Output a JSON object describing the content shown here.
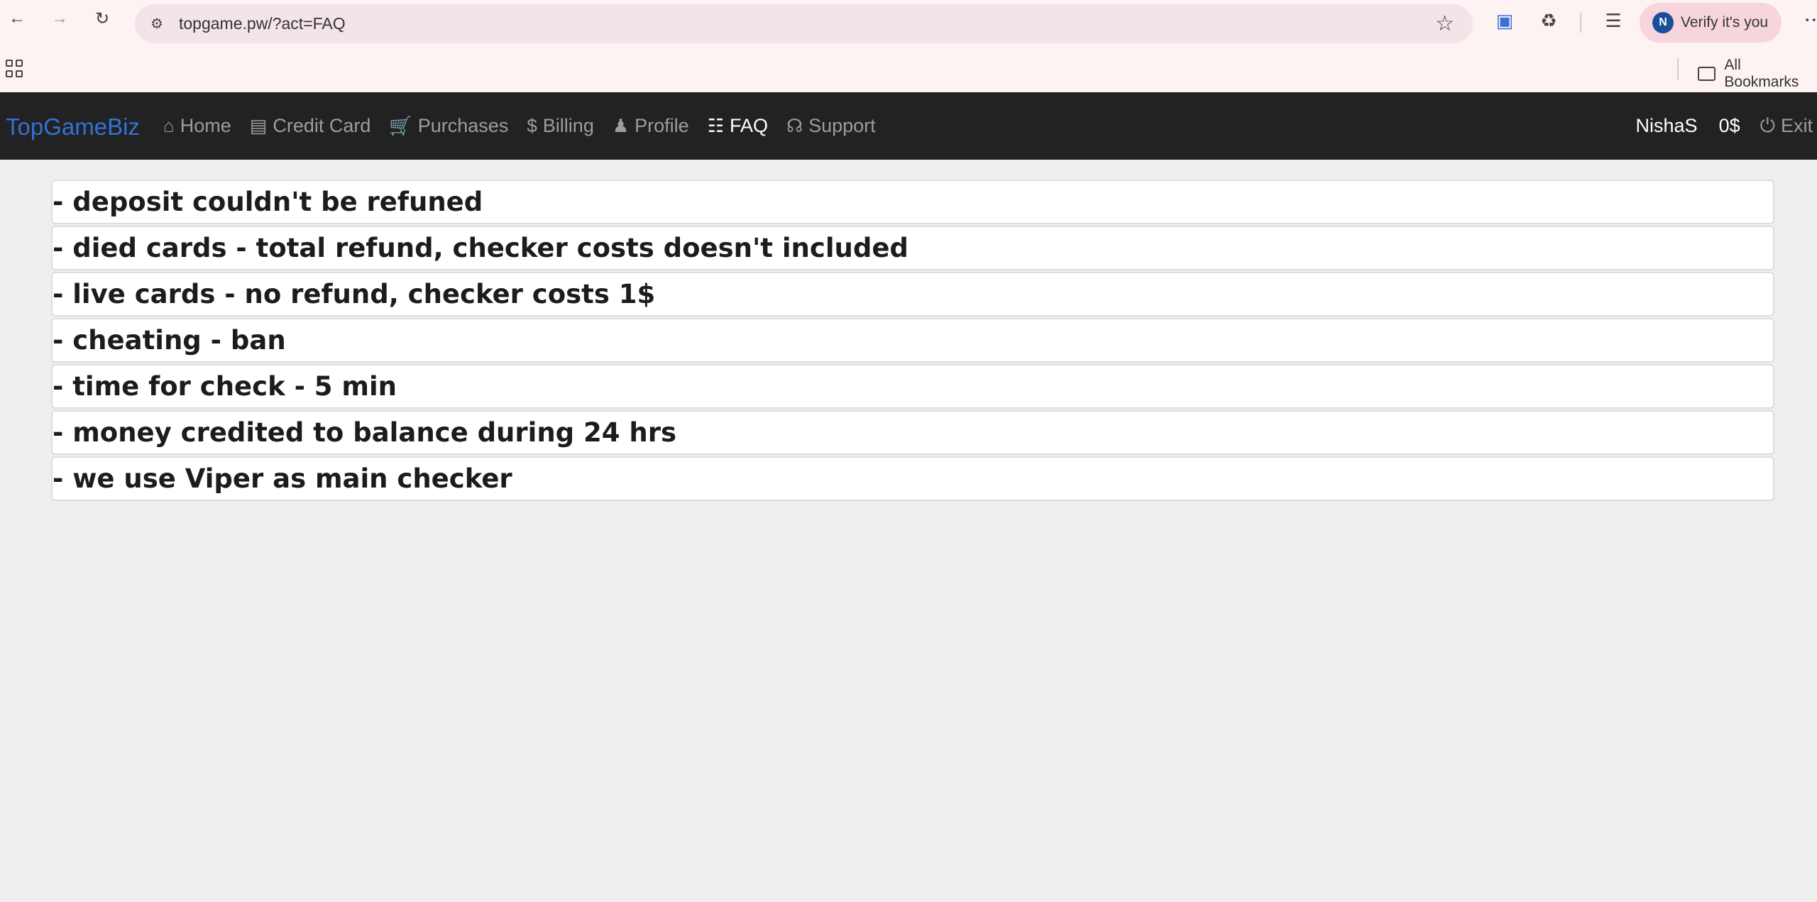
{
  "browser": {
    "url": "topgame.pw/?act=FAQ",
    "verify_label": "Verify it's you",
    "profile_initial": "N",
    "all_bookmarks": "All Bookmarks"
  },
  "site": {
    "brand": "TopGameBiz",
    "menu": [
      {
        "label": "Home",
        "icon": "home-icon"
      },
      {
        "label": "Credit Card",
        "icon": "credit-card-icon"
      },
      {
        "label": "Purchases",
        "icon": "cart-icon"
      },
      {
        "label": "Billing",
        "icon": "dollar-icon"
      },
      {
        "label": "Profile",
        "icon": "user-icon"
      },
      {
        "label": "FAQ",
        "icon": "book-icon",
        "active": true
      },
      {
        "label": "Support",
        "icon": "headphones-icon"
      }
    ],
    "username": "NishaS",
    "balance": "0$",
    "exit_label": "Exit"
  },
  "faq": [
    "- deposit couldn't be refuned",
    "- died cards - total refund, checker costs doesn't included",
    "- live cards - no refund, checker costs 1$",
    "- cheating - ban",
    "- time for check - 5 min",
    "- money credited to balance during 24 hrs",
    "- we use Viper as main checker"
  ]
}
